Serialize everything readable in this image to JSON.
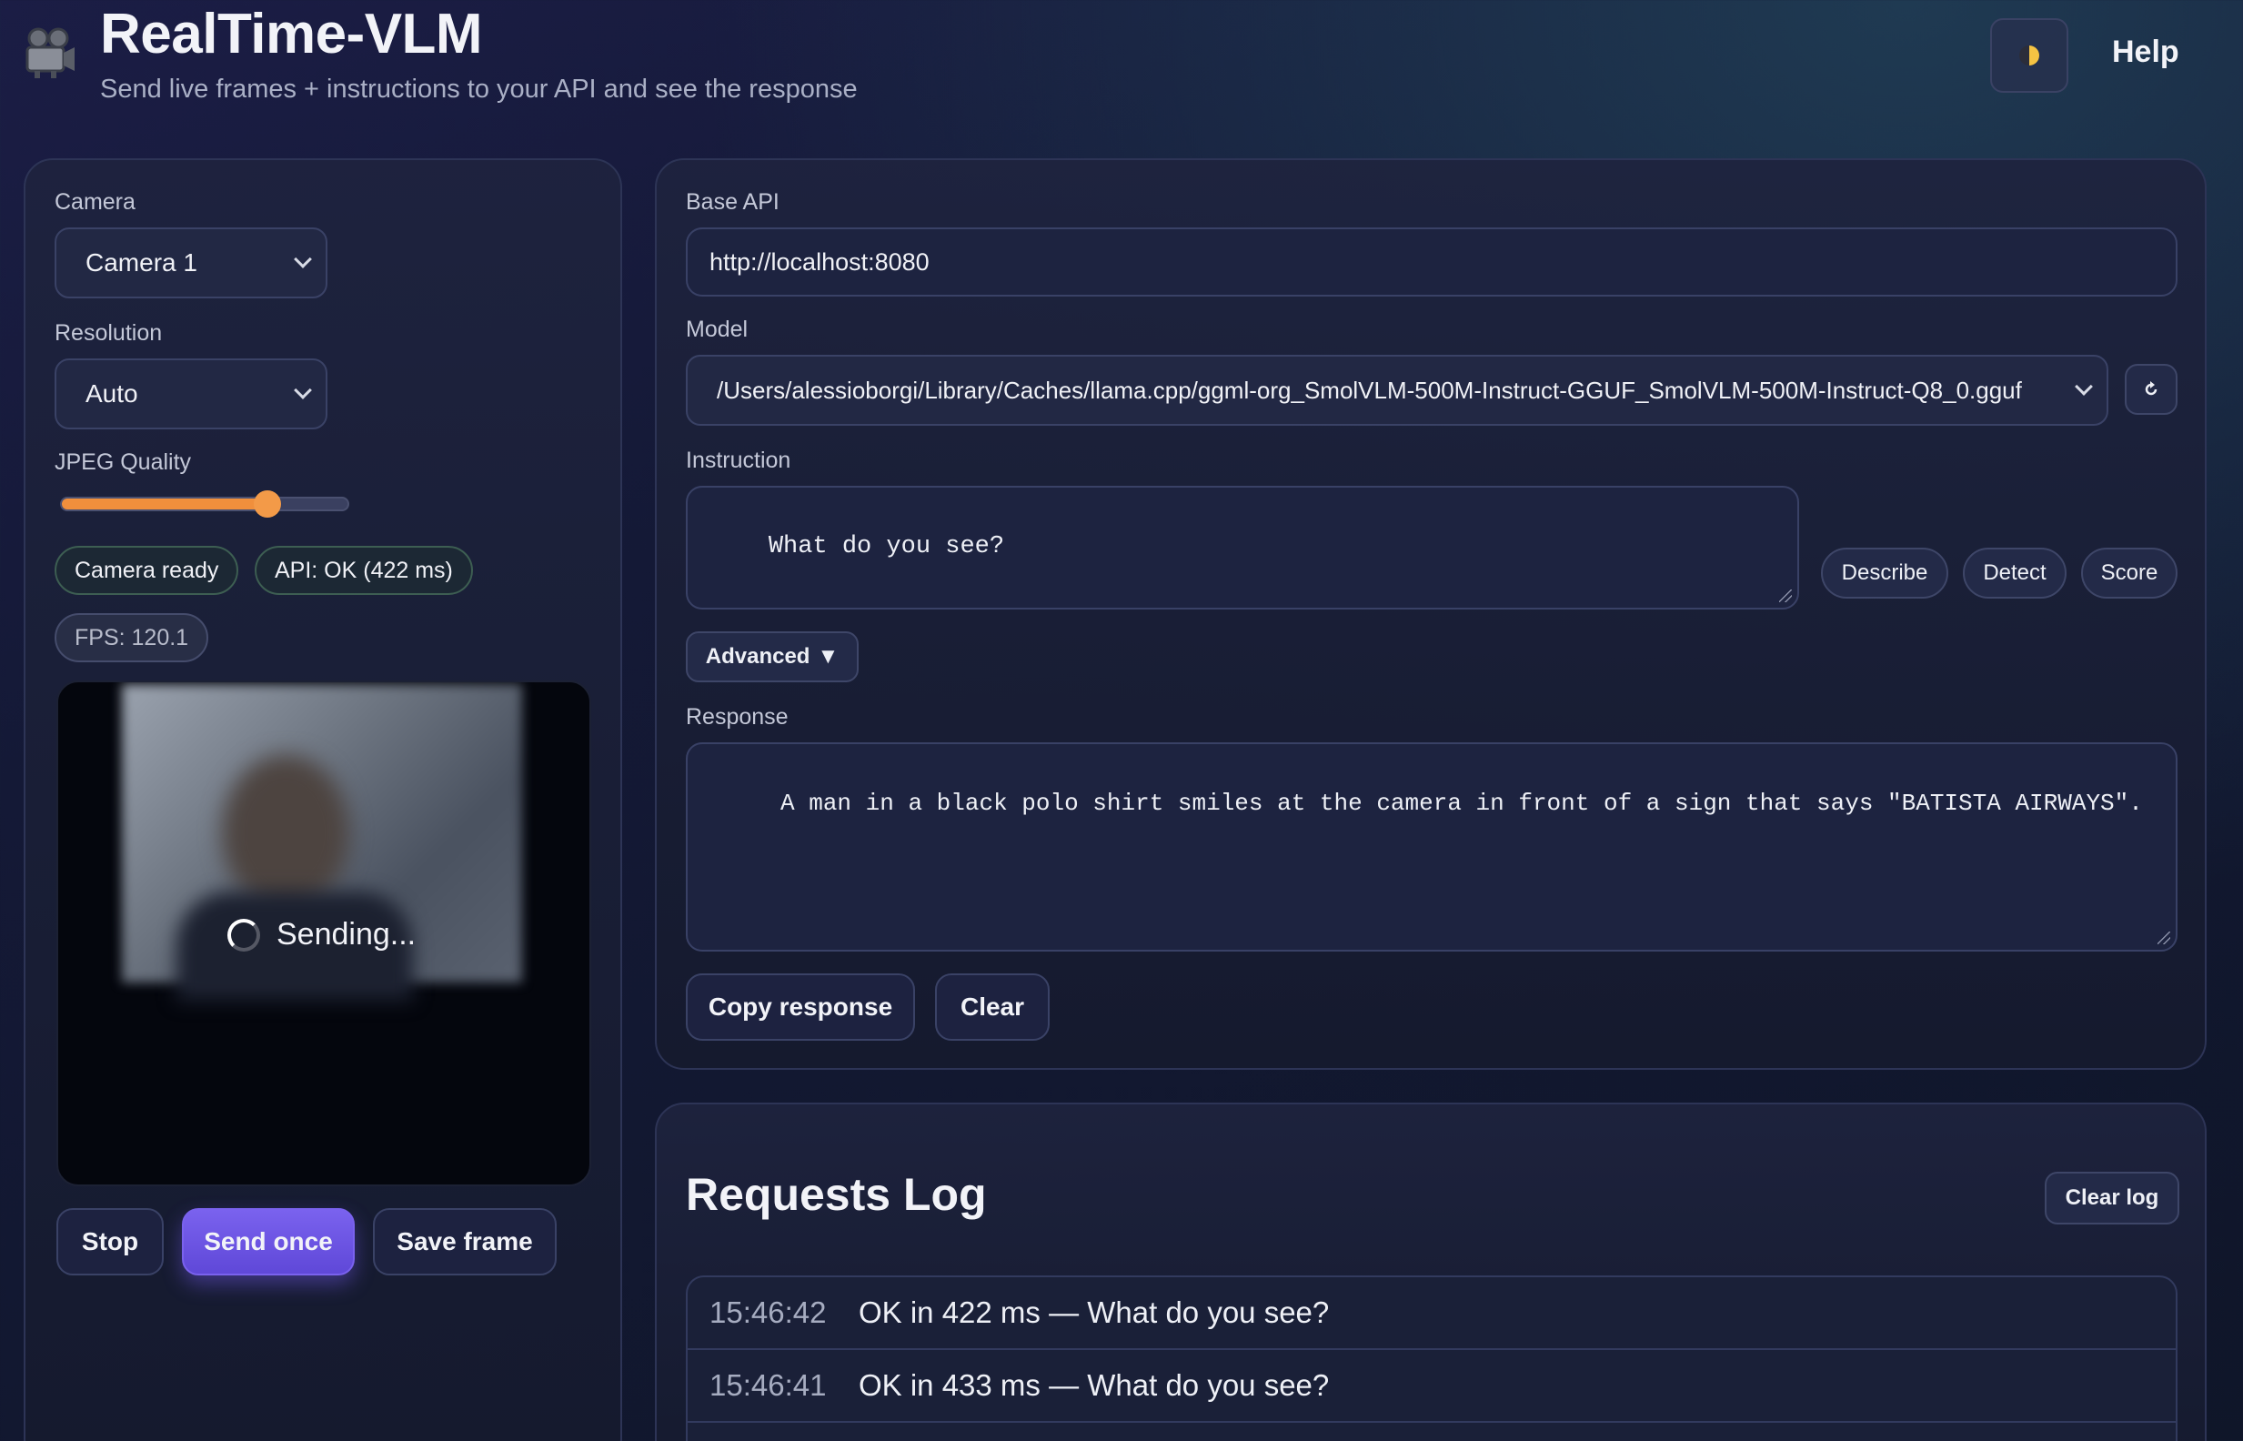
{
  "header": {
    "title": "RealTime-VLM",
    "subtitle": "Send live frames + instructions to your API and see the response",
    "theme_icon": "half-moon-icon",
    "help_label": "Help"
  },
  "controls": {
    "camera_label": "Camera",
    "camera_value": "Camera 1",
    "resolution_label": "Resolution",
    "resolution_value": "Auto",
    "jpeg_label": "JPEG Quality",
    "jpeg_quality": 0.72,
    "status": {
      "camera": "Camera ready",
      "api": "API: OK (422 ms)",
      "fps": "FPS: 120.1"
    },
    "overlay_text": "Sending...",
    "buttons": {
      "stop": "Stop",
      "send_once": "Send once",
      "save_frame": "Save frame"
    }
  },
  "api": {
    "base_label": "Base API",
    "base_value": "http://localhost:8080",
    "model_label": "Model",
    "model_value": "/Users/alessioborgi/Library/Caches/llama.cpp/ggml-org_SmolVLM-500M-Instruct-GGUF_SmolVLM-500M-Instruct-Q8_0.gguf",
    "refresh_icon": "refresh-icon",
    "instruction_label": "Instruction",
    "instruction_value": "What do you see?",
    "presets": [
      "Describe",
      "Detect",
      "Score"
    ],
    "advanced_label": "Advanced",
    "response_label": "Response",
    "response_value": " A man in a black polo shirt smiles at the camera in front of a sign that says \"BATISTA AIRWAYS\".",
    "copy_label": "Copy response",
    "clear_label": "Clear"
  },
  "log": {
    "title": "Requests Log",
    "clear_label": "Clear log",
    "entries": [
      {
        "time": "15:46:42",
        "text": "OK in 422 ms — What do you see?"
      },
      {
        "time": "15:46:41",
        "text": "OK in 433 ms — What do you see?"
      }
    ]
  },
  "colors": {
    "accent": "#6f56e6",
    "slider": "#f08f3c",
    "status_ok_border": "#3d5e52"
  }
}
